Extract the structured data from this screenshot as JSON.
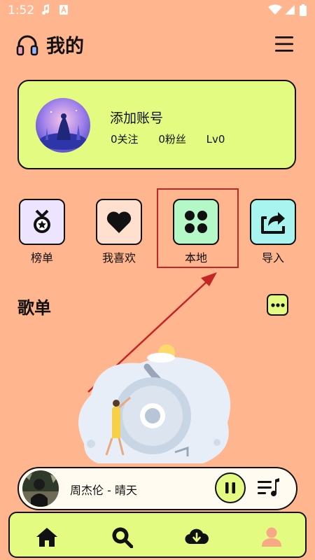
{
  "status_bar": {
    "time": "1:52",
    "icons": [
      "music-note-icon",
      "font-a-icon",
      "wifi-icon",
      "signal-icon",
      "battery-icon"
    ]
  },
  "header": {
    "title": "我的",
    "logo_icon": "headphones-icon",
    "menu_icon": "hamburger-menu-icon"
  },
  "profile": {
    "account_label": "添加账号",
    "follows": "0关注",
    "fans": "0粉丝",
    "level": "Lv0",
    "avatar_icon": "avatar-image"
  },
  "quick_actions": [
    {
      "label": "榜单",
      "icon": "medal-icon",
      "color": "#EDE5FF"
    },
    {
      "label": "我喜欢",
      "icon": "heart-icon",
      "color": "#FFE0CF"
    },
    {
      "label": "本地",
      "icon": "grid-dots-icon",
      "color": "#B5F8C7"
    },
    {
      "label": "导入",
      "icon": "import-share-icon",
      "color": "#A8F4EE"
    }
  ],
  "playlists": {
    "title": "歌单",
    "more_icon": "more-dots-icon"
  },
  "player": {
    "song": "周杰伦 - 晴天",
    "pause_icon": "pause-icon",
    "playlist_icon": "playlist-icon"
  },
  "tabs": [
    {
      "name": "home",
      "icon": "home-icon"
    },
    {
      "name": "search",
      "icon": "search-icon"
    },
    {
      "name": "download",
      "icon": "cloud-download-icon"
    },
    {
      "name": "profile",
      "icon": "person-icon"
    }
  ],
  "colors": {
    "background": "#FFB58E",
    "accent": "#E3FB80",
    "highlight_box": "#C42525",
    "arrow": "#C42525"
  }
}
